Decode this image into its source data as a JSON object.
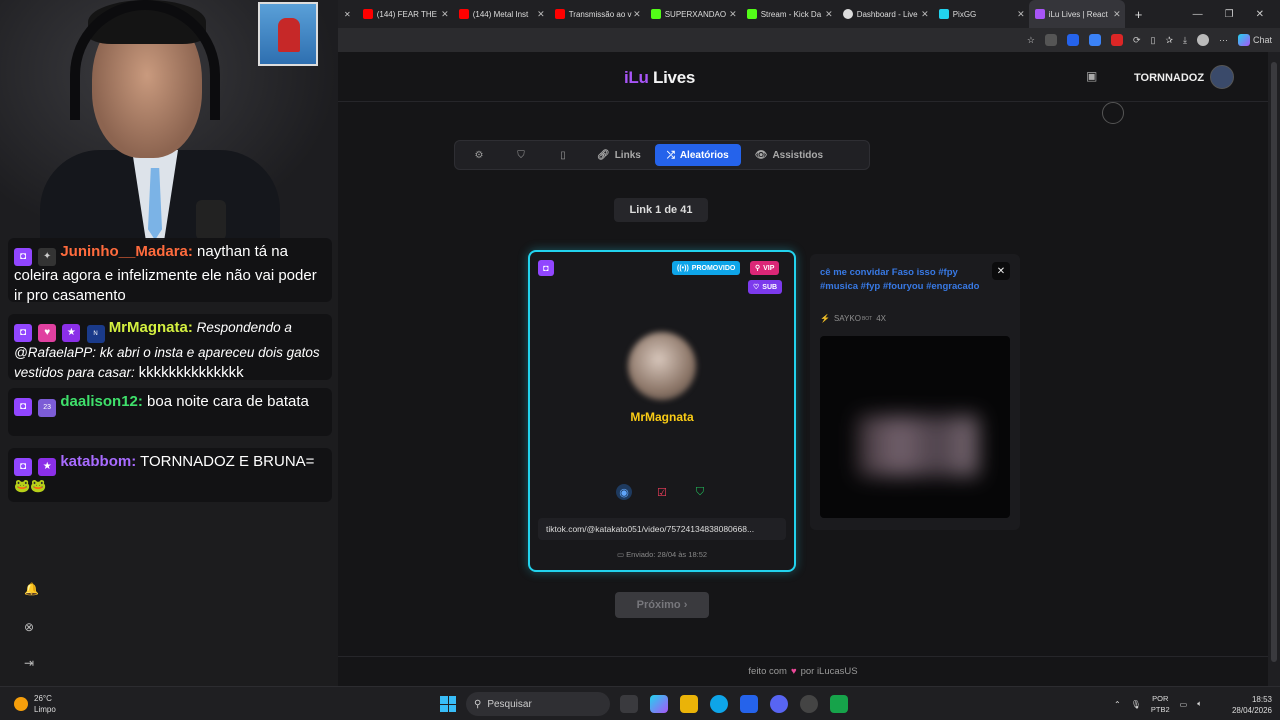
{
  "browser": {
    "tabs": [
      {
        "title": "(144) FEAR THE",
        "favicon_color": "#ff0000"
      },
      {
        "title": "(144) Metal Inst",
        "favicon_color": "#ff0000"
      },
      {
        "title": "Transmissão ao v",
        "favicon_color": "#ff0000"
      },
      {
        "title": "SUPERXANDAO",
        "favicon_color": "#53fc18"
      },
      {
        "title": "Stream - Kick Da",
        "favicon_color": "#53fc18"
      },
      {
        "title": "Dashboard - Live",
        "favicon_color": "#dddddd"
      },
      {
        "title": "PixGG",
        "favicon_color": "#22d3ee"
      },
      {
        "title": "iLu Lives | React",
        "favicon_color": "#a855f7",
        "active": true
      }
    ],
    "new_tab": "+",
    "chat_label": "Chat"
  },
  "app": {
    "logo_ilu": "iLu",
    "logo_lives": "Lives",
    "username": "TORNNADOZ",
    "nav": {
      "links": "Links",
      "random": "Aleatórios",
      "watched": "Assistidos"
    },
    "counter": "Link 1 de 41",
    "card": {
      "badge_promo": "PROMOVIDO",
      "badge_vip": "VIP",
      "badge_sub": "SUB",
      "user": "MrMagnata",
      "url": "tiktok.com/@katakato051/video/75724134838080668...",
      "sent": "Enviado: 28/04 às 18:52"
    },
    "preview": {
      "text": "cê me convidar Faso isso #fpy #musica #fyp #fouryou #engracado",
      "sender": "SAYKO",
      "sender_sup": "BOT",
      "count": "4X"
    },
    "next_button": "Próximo ›",
    "footer_before": "feito com",
    "footer_after": "por iLucasUS"
  },
  "chat": [
    {
      "user": "Juninho__Madara:",
      "color": "#ff6b3d",
      "text": " naythan tá na coleira agora e infelizmente ele não vai poder ir pro casamento"
    },
    {
      "user": "MrMagnata:",
      "color": "#d4f040",
      "text_italic": " Respondendo a @RafaelaPP: kk abri o insta e apareceu dois gatos vestidos para casar: ",
      "text": " kkkkkkkkkkkkkk"
    },
    {
      "user": "daalison12:",
      "color": "#3fe06b",
      "text": " boa noite cara de batata"
    },
    {
      "user": "katabbom:",
      "color": "#a86bff",
      "text": " TORNNADOZ E BRUNA="
    }
  ],
  "taskbar": {
    "temperature": "26°C",
    "weather": "Limpo",
    "search_placeholder": "Pesquisar",
    "lang1": "POR",
    "lang2": "PTB2",
    "time": "18:53",
    "date": "28/04/2026"
  }
}
